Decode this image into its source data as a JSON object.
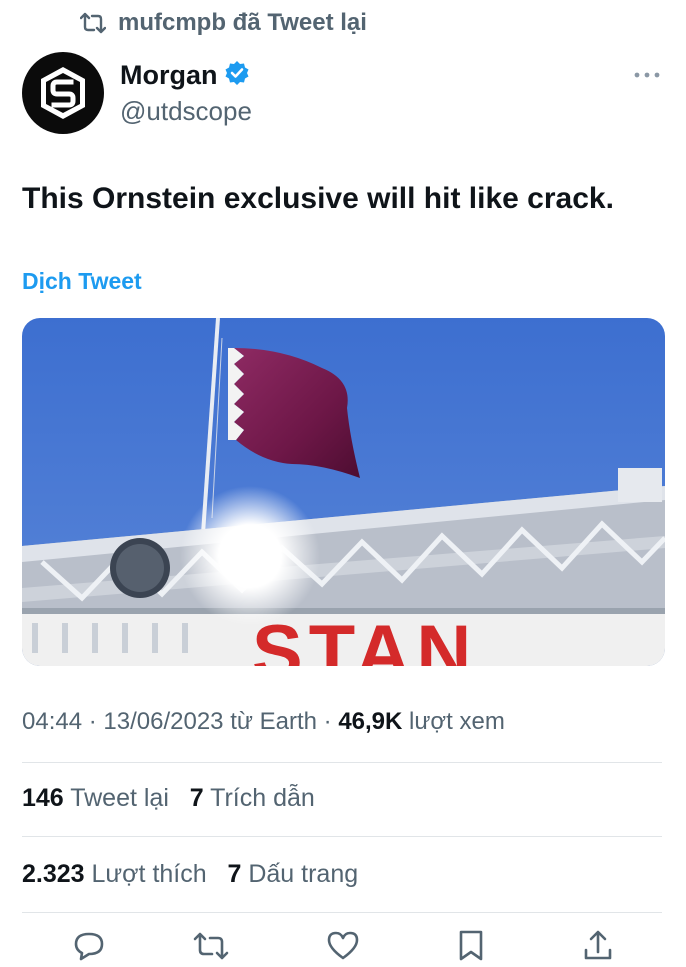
{
  "retweet": {
    "text": "mufcmpb đã Tweet lại",
    "icon": "retweet-icon"
  },
  "author": {
    "name": "Morgan",
    "handle": "@utdscope",
    "verified": true,
    "avatar_icon": "avatar-logo"
  },
  "more_icon": "more-icon",
  "tweet": {
    "text": "This Ornstein exclusive will hit like crack.",
    "translate": "Dịch Tweet"
  },
  "media": {
    "description_icon": "stadium-photo",
    "sign_text": "STAN"
  },
  "meta": {
    "time": "04:44",
    "sep1": "·",
    "date": "13/06/2023",
    "source": "từ Earth",
    "sep2": "·",
    "views": "46,9K",
    "views_label": "lượt xem"
  },
  "stats": {
    "retweets": "146",
    "retweets_label": "Tweet lại",
    "quotes": "7",
    "quotes_label": "Trích dẫn",
    "likes": "2.323",
    "likes_label": "Lượt thích",
    "bookmarks": "7",
    "bookmarks_label": "Dấu trang"
  },
  "actions": [
    "reply-icon",
    "retweet-icon",
    "like-icon",
    "bookmark-icon",
    "share-icon"
  ],
  "colors": {
    "accent": "#1d9bf0",
    "secondary": "#536471",
    "text": "#0f1419",
    "sky": "#3a6fcf",
    "flag": "#7b1e52"
  }
}
